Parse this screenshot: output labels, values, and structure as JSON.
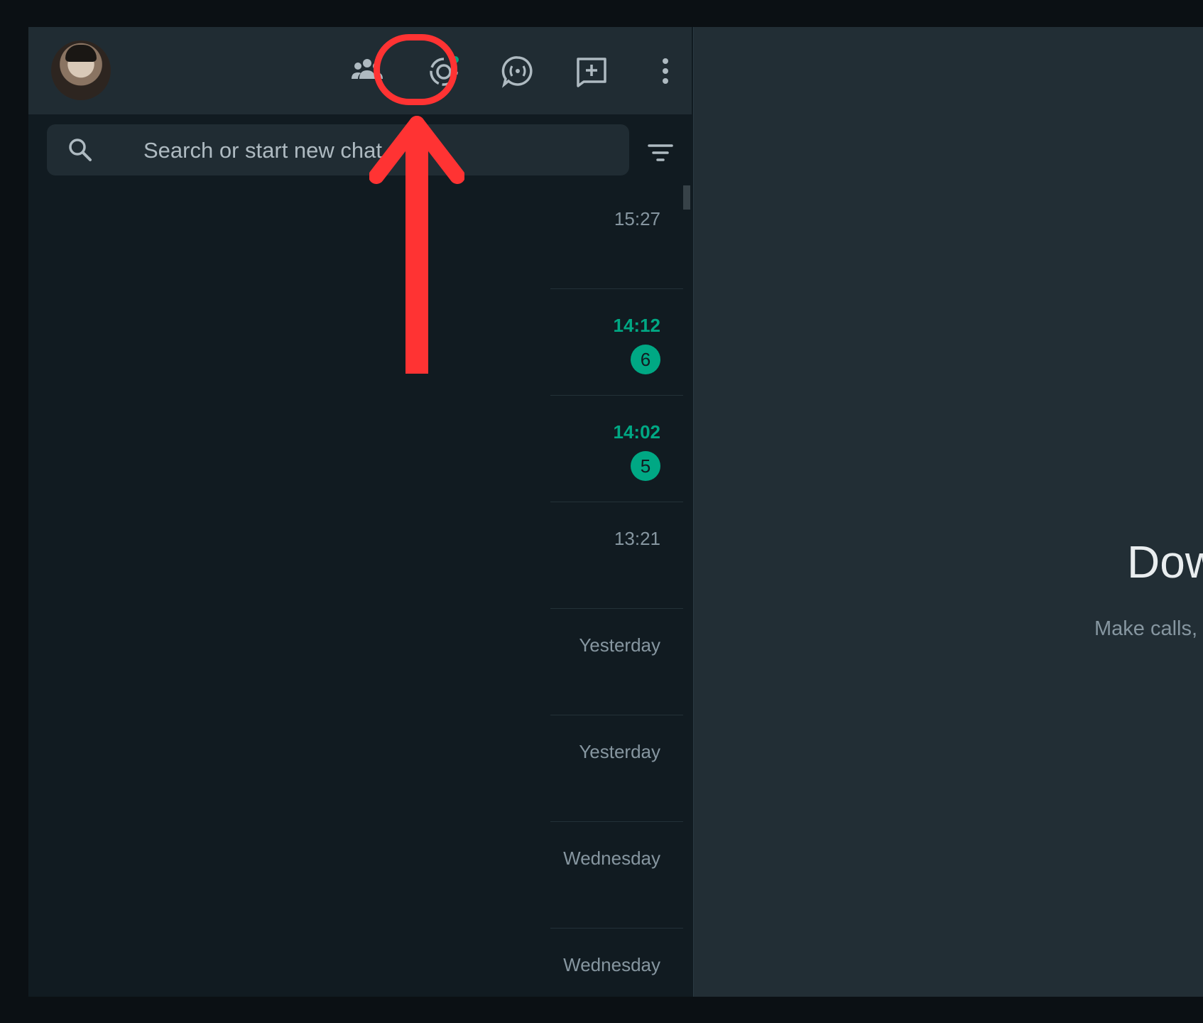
{
  "header": {
    "avatar_alt": "Profile photo",
    "icons": [
      "communities-icon",
      "status-icon",
      "channels-icon",
      "new-chat-icon",
      "menu-icon"
    ]
  },
  "search": {
    "placeholder": "Search or start new chat"
  },
  "chats": [
    {
      "time": "15:27",
      "unread": false,
      "badge": ""
    },
    {
      "time": "14:12",
      "unread": true,
      "badge": "6"
    },
    {
      "time": "14:02",
      "unread": true,
      "badge": "5"
    },
    {
      "time": "13:21",
      "unread": false,
      "badge": ""
    },
    {
      "time": "Yesterday",
      "unread": false,
      "badge": ""
    },
    {
      "time": "Yesterday",
      "unread": false,
      "badge": ""
    },
    {
      "time": "Wednesday",
      "unread": false,
      "badge": ""
    },
    {
      "time": "Wednesday",
      "unread": false,
      "badge": ""
    }
  ],
  "main": {
    "title": "Dow",
    "subtitle": "Make calls, s"
  },
  "colors": {
    "accent": "#00a884",
    "annotation": "#ff3333",
    "panel": "#202c33",
    "background": "#111b21"
  }
}
